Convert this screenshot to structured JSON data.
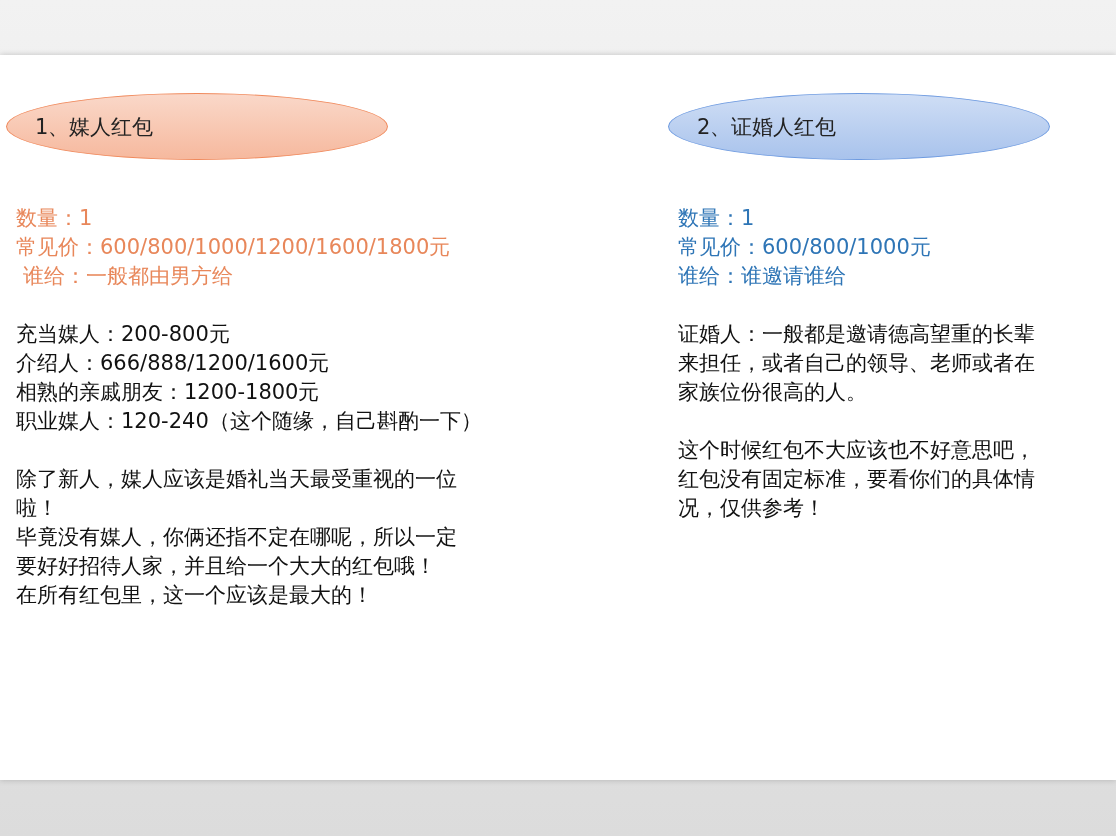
{
  "sections": [
    {
      "title": "1、媒人红包",
      "color": "#e8875a",
      "facts": [
        "数量：1",
        "常见价：600/800/1000/1200/1600/1800元",
        " 谁给：一般都由男方给"
      ],
      "paragraphs": [
        [
          "充当媒人：200-800元",
          "介绍人：666/888/1200/1600元",
          "相熟的亲戚朋友：1200-1800元",
          "职业媒人：120-240（这个随缘，自己斟酌一下）"
        ],
        [
          "除了新人，媒人应该是婚礼当天最受重视的一位",
          "啦！",
          "毕竟没有媒人，你俩还指不定在哪呢，所以一定",
          "要好好招待人家，并且给一个大大的红包哦！",
          "在所有红包里，这一个应该是最大的！"
        ]
      ]
    },
    {
      "title": "2、证婚人红包",
      "color": "#2e75b6",
      "facts": [
        "数量：1",
        "常见价：600/800/1000元",
        "谁给：谁邀请谁给"
      ],
      "paragraphs": [
        [
          "证婚人：一般都是邀请德高望重的长辈",
          "来担任，或者自己的领导、老师或者在",
          "家族位份很高的人。"
        ],
        [
          "这个时候红包不大应该也不好意思吧，",
          "红包没有固定标准，要看你们的具体情",
          "况，仅供参考！"
        ]
      ]
    }
  ]
}
